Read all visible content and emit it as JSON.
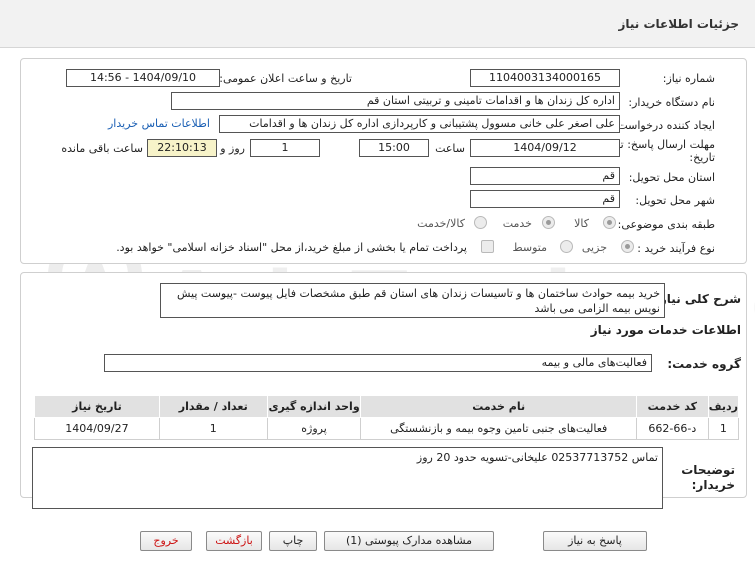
{
  "page": {
    "title": "جزئیات اطلاعات نیاز"
  },
  "watermark": {
    "text": "AriaTender.net"
  },
  "form": {
    "need_number_label": "شماره نیاز:",
    "need_number": "1104003134000165",
    "announce_label": "تاریخ و ساعت اعلان عمومی:",
    "announce_value": "1404/09/10 - 14:56",
    "buyer_label": "نام دستگاه خریدار:",
    "buyer_value": "اداره کل زندان ها و اقدامات تامینی و تربیتی استان قم",
    "creator_label": "ایجاد کننده درخواست:",
    "creator_value": "علی اصغر علی خانی مسوول پشتیبانی و کارپردازی اداره کل زندان ها و اقدامات",
    "contact_link": "اطلاعات تماس خریدار",
    "deadline_label": "مهلت ارسال پاسخ: تا تاریخ:",
    "deadline_date": "1404/09/12",
    "time_label": "ساعت",
    "deadline_time": "15:00",
    "days_value": "1",
    "days_label": "روز و",
    "remaining_value": "22:10:13",
    "remaining_label": "ساعت باقی مانده",
    "province_label": "استان محل تحویل:",
    "province_value": "قم",
    "city_label": "شهر محل تحویل:",
    "city_value": "قم",
    "category_label": "طبقه بندی موضوعی:",
    "category_options": [
      "کالا",
      "خدمت",
      "کالا/خدمت"
    ],
    "process_label": "نوع فرآیند خرید :",
    "process_options": [
      "جزیی",
      "متوسط"
    ],
    "payment_note": "پرداخت تمام یا بخشی از مبلغ خرید،از محل \"اسناد خزانه اسلامی\" خواهد بود."
  },
  "details": {
    "description_label": "شرح کلی نیاز:",
    "description_value": "خرید بیمه حوادث ساختمان ها و تاسیسات زندان های استان قم طبق مشخصات فایل پیوست -پیوست پیش نویس بیمه الزامی می باشد",
    "services_header": "اطلاعات خدمات مورد نیاز",
    "service_group_label": "گروه خدمت:",
    "service_group_value": "فعالیت‌های مالی و بیمه"
  },
  "table": {
    "headers": [
      "ردیف",
      "کد خدمت",
      "نام خدمت",
      "واحد اندازه گیری",
      "تعداد / مقدار",
      "تاریخ نیاز"
    ],
    "rows": [
      [
        "1",
        "د-66-662",
        "فعالیت‌های جنبی تامین وجوه بیمه و بازنشستگی",
        "پروژه",
        "1",
        "1404/09/27"
      ]
    ]
  },
  "notes": {
    "label": "توضیحات خریدار:",
    "value": "تماس 02537713752 علیخانی-تسویه حدود 20 روز"
  },
  "buttons": {
    "reply": "پاسخ به نیاز",
    "attachments": "مشاهده مدارک پیوستی (1)",
    "print": "چاپ",
    "back": "بازگشت",
    "exit": "خروج"
  }
}
